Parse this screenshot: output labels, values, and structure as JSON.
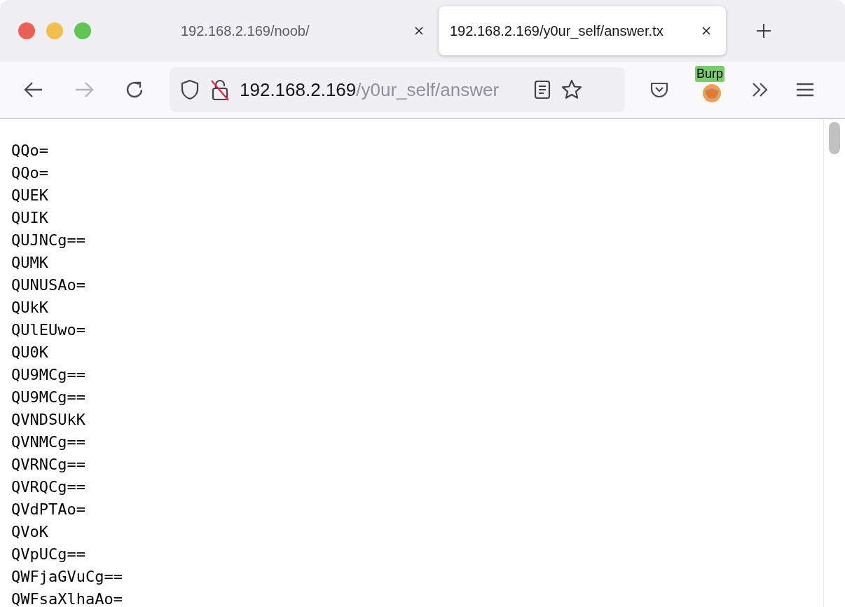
{
  "tabs": [
    {
      "title": "192.168.2.169/noob/",
      "selected": false
    },
    {
      "title": "192.168.2.169/y0ur_self/answer.tx",
      "selected": true
    }
  ],
  "toolbar": {
    "back_disabled": false,
    "forward_disabled": true
  },
  "address_bar": {
    "host": "192.168.2.169",
    "path": "/y0ur_self/answer"
  },
  "extension_badge": "Burp",
  "lines": [
    "QQo=",
    "QQo=",
    "QUEK",
    "QUIK",
    "QUJNCg==",
    "QUMK",
    "QUNUSAo=",
    "QUkK",
    "QUlEUwo=",
    "QU0K",
    "QU9MCg==",
    "QU9MCg==",
    "QVNDSUkK",
    "QVNMCg==",
    "QVRNCg==",
    "QVRQCg==",
    "QVdPTAo=",
    "QVoK",
    "QVpUCg==",
    "QWFjaGVuCg==",
    "QWFsaXlhaAo="
  ]
}
